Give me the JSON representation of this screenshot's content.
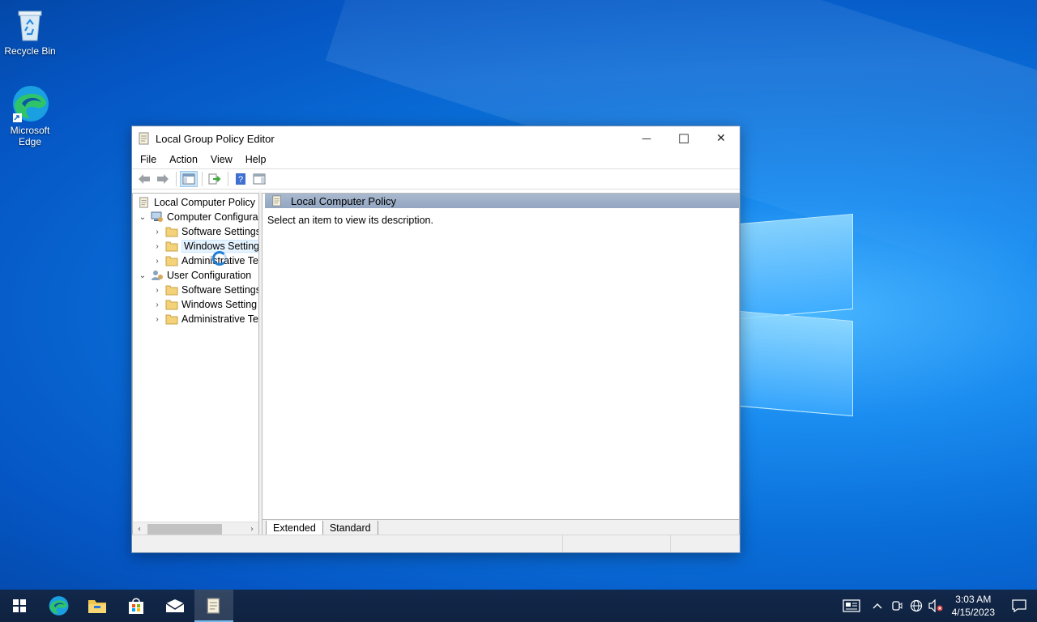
{
  "desktop": {
    "icons": [
      {
        "label": "Recycle Bin"
      },
      {
        "label": "Microsoft Edge"
      }
    ]
  },
  "window": {
    "title": "Local Group Policy Editor",
    "controls": {
      "minimize": "—",
      "maximize": "☐",
      "close": "✕"
    },
    "menu": [
      "File",
      "Action",
      "View",
      "Help"
    ]
  },
  "tree": {
    "root": "Local Computer Policy",
    "items": [
      {
        "label": "Computer Configura",
        "arrow": "⌄"
      },
      {
        "label": "Software Settings",
        "arrow": "›"
      },
      {
        "label": "Windows Settings",
        "arrow": "›"
      },
      {
        "label": "Administrative Te",
        "arrow": "›"
      },
      {
        "label": "User Configuration",
        "arrow": "⌄"
      },
      {
        "label": "Software Settings",
        "arrow": "›"
      },
      {
        "label": "Windows Setting",
        "arrow": "›"
      },
      {
        "label": "Administrative Te",
        "arrow": "›"
      }
    ],
    "scroll_left": "‹",
    "scroll_right": "›"
  },
  "right_pane": {
    "header": "Local Computer Policy",
    "description": "Select an item to view its description.",
    "tabs": [
      "Extended",
      "Standard"
    ]
  },
  "taskbar": {
    "time": "3:03 AM",
    "date": "4/15/2023"
  },
  "colors": {
    "accent": "#0078d7",
    "folder": "#e8c15a"
  }
}
